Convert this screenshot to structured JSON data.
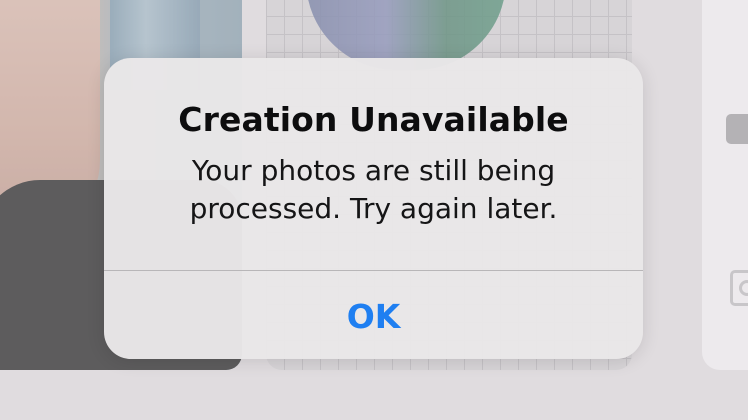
{
  "background": {
    "left_photo_icon": "photo-thumbnail",
    "middle_photo_icon": "photo-thumbnail",
    "right_panel_icons": [
      "toggle-square-icon",
      "camera-icon"
    ]
  },
  "alert": {
    "title": "Creation Unavailable",
    "message": "Your photos are still being processed. Try again later.",
    "ok_label": "OK",
    "accent_color": "#1f7ff1"
  }
}
